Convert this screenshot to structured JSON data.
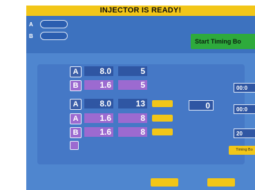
{
  "banner": "INJECTOR IS READY!",
  "injectors": [
    {
      "letter": "A",
      "pill": "",
      "color": "#3b5ea8"
    },
    {
      "letter": "B",
      "pill": "",
      "color": "#9c6ad0"
    }
  ],
  "center": {
    "title": "",
    "subtitle": ""
  },
  "start_button": "Start Timing Bo",
  "headers": {
    "phase": "",
    "side": "",
    "flow": "",
    "volume": "",
    "phase_delay": ""
  },
  "rows": [
    {
      "phase": "",
      "side": "A",
      "flow": "8.0",
      "volume": "5",
      "button": ""
    },
    {
      "phase": "",
      "side": "B",
      "flow": "1.6",
      "volume": "5",
      "button": ""
    },
    {
      "phase": "",
      "side": "A",
      "flow": "8.0",
      "volume": "13",
      "button": ""
    },
    {
      "phase": "",
      "side": "A",
      "flow": "1.6",
      "volume": "8",
      "button": ""
    },
    {
      "phase": "",
      "side": "B",
      "flow": "1.6",
      "volume": "8",
      "button": ""
    },
    {
      "phase": "",
      "side": "",
      "flow": "",
      "volume": "",
      "button": ""
    }
  ],
  "pause": {
    "label": "",
    "value": "0"
  },
  "right_panel": {
    "box1": {
      "label": "",
      "value": "00:0"
    },
    "box2": {
      "label": "",
      "value": "00:0"
    },
    "box3": {
      "label": "",
      "value": "20"
    },
    "timing_button": "Timing Bo"
  },
  "bottom_buttons": [
    "",
    ""
  ],
  "colors": {
    "banner": "#f2c618",
    "background": "#4f86cf",
    "start_button": "#2eaa3c",
    "side_a": "#3b5ea8",
    "side_b": "#9c6ad0"
  }
}
